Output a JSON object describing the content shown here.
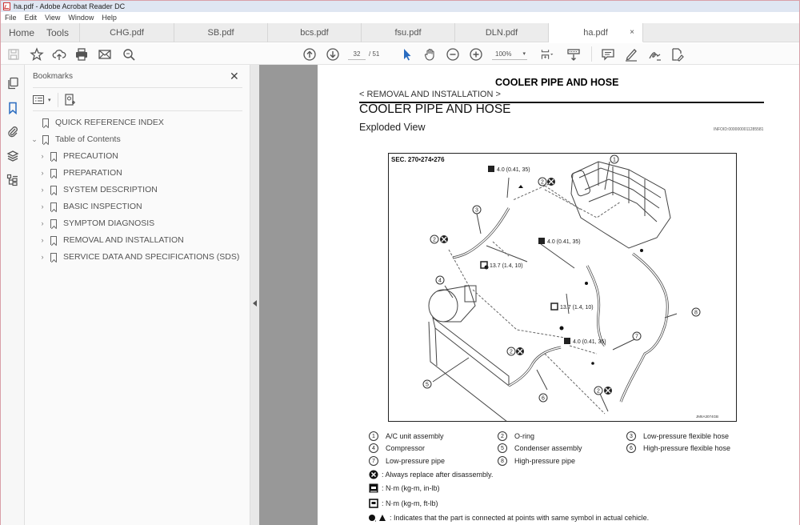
{
  "window": {
    "title": "ha.pdf - Adobe Acrobat Reader DC"
  },
  "menu": [
    "File",
    "Edit",
    "View",
    "Window",
    "Help"
  ],
  "tabs": {
    "home": "Home",
    "tools": "Tools",
    "documents": [
      {
        "label": "CHG.pdf",
        "active": false
      },
      {
        "label": "SB.pdf",
        "active": false
      },
      {
        "label": "bcs.pdf",
        "active": false
      },
      {
        "label": "fsu.pdf",
        "active": false
      },
      {
        "label": "DLN.pdf",
        "active": false
      },
      {
        "label": "ha.pdf",
        "active": true
      }
    ],
    "close_glyph": "×"
  },
  "toolbar": {
    "current_page": "32",
    "total_pages": "/ 51",
    "zoom_level": "100%",
    "zoom_caret": "▾"
  },
  "bookmarks": {
    "title": "Bookmarks",
    "close_glyph": "✕",
    "items": [
      {
        "label": "QUICK REFERENCE INDEX",
        "level": 0,
        "expander": ""
      },
      {
        "label": "Table of Contents",
        "level": 0,
        "expander": "⌄"
      },
      {
        "label": "PRECAUTION",
        "level": 1,
        "expander": "›"
      },
      {
        "label": "PREPARATION",
        "level": 1,
        "expander": "›"
      },
      {
        "label": "SYSTEM DESCRIPTION",
        "level": 1,
        "expander": "›"
      },
      {
        "label": "BASIC INSPECTION",
        "level": 1,
        "expander": "›"
      },
      {
        "label": "SYMPTOM DIAGNOSIS",
        "level": 1,
        "expander": "›"
      },
      {
        "label": "REMOVAL AND INSTALLATION",
        "level": 1,
        "expander": "›"
      },
      {
        "label": "SERVICE DATA AND SPECIFICATIONS (SDS)",
        "level": 1,
        "expander": "›"
      }
    ]
  },
  "document": {
    "header_title": "COOLER PIPE AND HOSE",
    "breadcrumb": "< REMOVAL AND INSTALLATION >",
    "section_title": "COOLER PIPE AND HOSE",
    "subsection_title": "Exploded View",
    "info_id": "INFOID:0000000011285581",
    "diagram": {
      "section_ref": "SEC. 270•274•276",
      "figure_id": "JMIIA3074GB",
      "torque_labels": [
        "4.0 (0.41, 35)",
        "4.0 (0.41, 35)",
        "13.7 (1.4, 10)",
        "13.7 (1.4, 10)",
        "4.0 (0.41, 35)"
      ],
      "callouts": [
        "1",
        "2",
        "3",
        "2",
        "4",
        "2",
        "5",
        "6",
        "7",
        "8",
        "2"
      ]
    },
    "legend": [
      {
        "num": "1",
        "label": "A/C unit assembly"
      },
      {
        "num": "2",
        "label": "O-ring"
      },
      {
        "num": "3",
        "label": "Low-pressure flexible hose"
      },
      {
        "num": "4",
        "label": "Compressor"
      },
      {
        "num": "5",
        "label": "Condenser assembly"
      },
      {
        "num": "6",
        "label": "High-pressure flexible hose"
      },
      {
        "num": "7",
        "label": "Low-pressure pipe"
      },
      {
        "num": "8",
        "label": "High-pressure pipe"
      }
    ],
    "symbols": [
      {
        "icon": "replace-icon",
        "text": ": Always replace after disassembly."
      },
      {
        "icon": "torque-inlb-icon",
        "text": ": N·m (kg-m, in-lb)"
      },
      {
        "icon": "torque-ftlb-icon",
        "text": ": N·m (kg-m, ft-lb)"
      },
      {
        "icon": "connection-symbols-icon",
        "text": ": Indicates that the part is connected at points with same symbol in actual cehicle."
      }
    ]
  }
}
